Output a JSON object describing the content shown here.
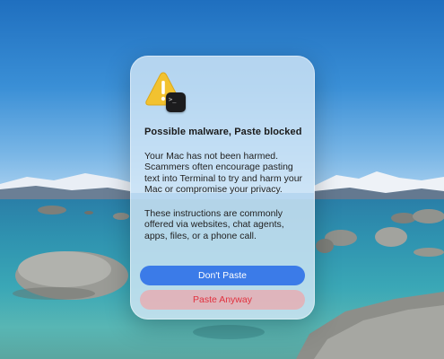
{
  "dialog": {
    "title": "Possible malware, Paste blocked",
    "paragraph1": "Your Mac has not been harmed. Scammers often encourage pasting text into Terminal to try and harm your Mac or compromise your privacy.",
    "paragraph2": "These instructions are commonly offered via websites, chat agents, apps, files, or a phone call.",
    "primary_button": "Don't Paste",
    "secondary_button": "Paste Anyway",
    "badge_icon_glyph": ">_",
    "icons": [
      "warning-triangle-icon",
      "terminal-icon"
    ],
    "colors": {
      "primary_button_bg": "#3b7be8",
      "secondary_button_text": "#e0323f",
      "warning_yellow": "#f2c230"
    }
  }
}
